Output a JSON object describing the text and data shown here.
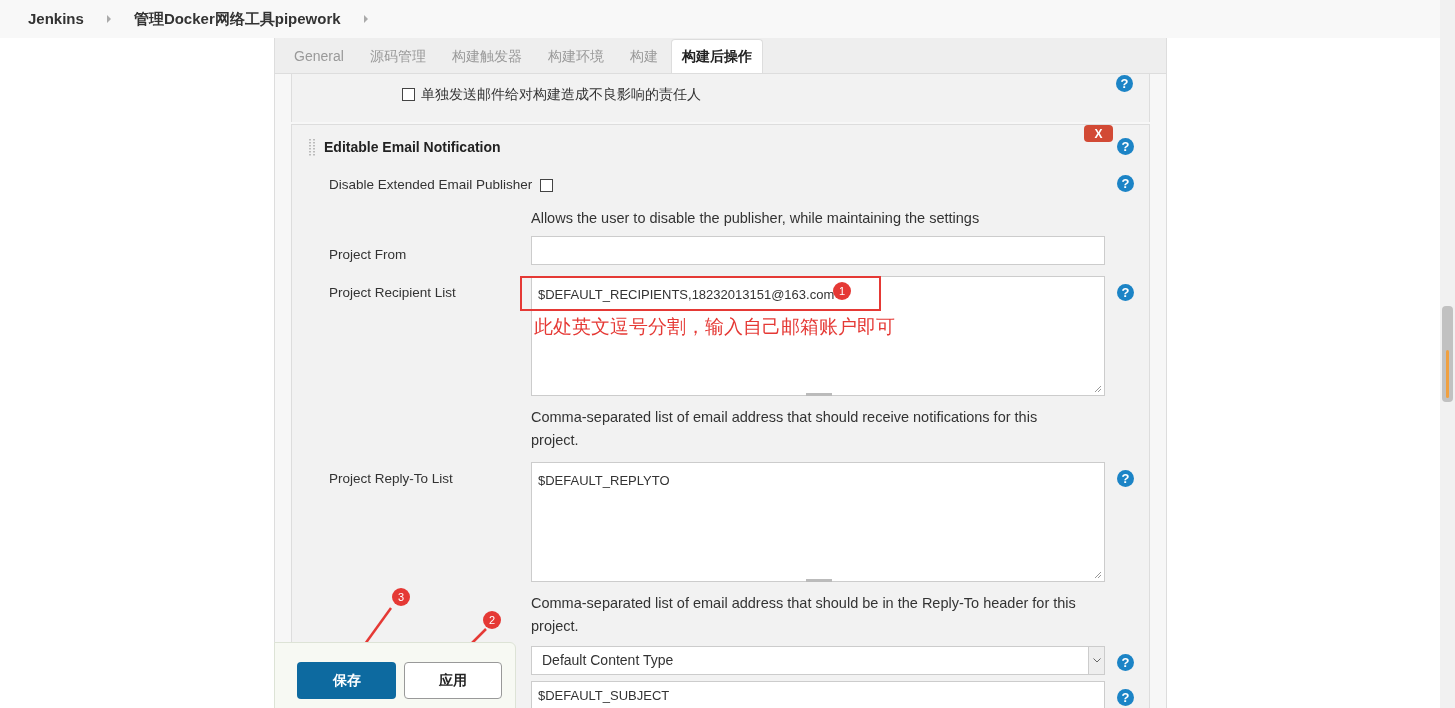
{
  "breadcrumbs": [
    {
      "label": "Jenkins"
    },
    {
      "label": "管理Docker网络工具pipework"
    }
  ],
  "tabs": [
    {
      "label": "General",
      "selected": false
    },
    {
      "label": "源码管理",
      "selected": false
    },
    {
      "label": "构建触发器",
      "selected": false
    },
    {
      "label": "构建环境",
      "selected": false
    },
    {
      "label": "构建",
      "selected": false
    },
    {
      "label": "构建后操作",
      "selected": true
    }
  ],
  "blame_section": {
    "label": "单独发送邮件给对构建造成不良影响的责任人",
    "checked": false,
    "help": "?"
  },
  "email_section": {
    "title": "Editable Email Notification",
    "delete_button": "X",
    "help": "?",
    "fields": [
      {
        "kind": "checkbox",
        "label": "Disable Extended Email Publisher",
        "checked": false,
        "help": "?",
        "description": "Allows the user to disable the publisher, while maintaining the settings"
      },
      {
        "kind": "text",
        "label": "Project From"
      },
      {
        "kind": "textarea",
        "label": "Project Recipient List",
        "value": "$DEFAULT_RECIPIENTS,18232013151@163.com",
        "help": "?",
        "description": "Comma-separated list of email address that should receive notifications for this project."
      },
      {
        "kind": "textarea",
        "label": "Project Reply-To List",
        "value": "$DEFAULT_REPLYTO",
        "help": "?",
        "description": "Comma-separated list of email address that should be in the Reply-To header for this project."
      },
      {
        "kind": "select",
        "value": "Default Content Type",
        "help": "?"
      },
      {
        "kind": "text",
        "value": "$DEFAULT_SUBJECT",
        "help": "?"
      }
    ]
  },
  "bottom_bar": {
    "buttons": [
      {
        "label": "保存",
        "kind": "primary"
      },
      {
        "label": "应用",
        "kind": "secondary"
      }
    ]
  },
  "annotations": {
    "note": "此处英文逗号分割，输入自己邮箱账户即可",
    "markers": [
      "1",
      "2",
      "3"
    ]
  }
}
